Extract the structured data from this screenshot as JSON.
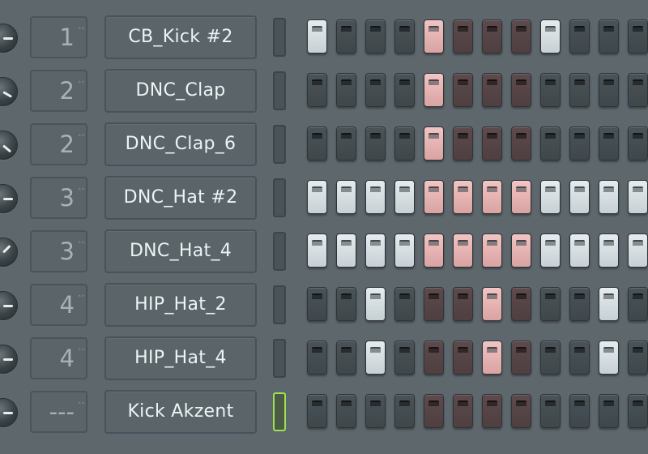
{
  "colors": {
    "background": "#5d676c",
    "step_off_grey": "#454d51",
    "step_off_brown": "#574546",
    "step_on_white": "#d6dee1",
    "step_on_pink": "#e6b3b2",
    "selected_led": "#9fe04e"
  },
  "channels": [
    {
      "channel": "1",
      "name": "CB_Kick #2",
      "knob_angle": 0,
      "selected": false,
      "steps": [
        1,
        0,
        0,
        0,
        1,
        0,
        0,
        0,
        1,
        0,
        0,
        0
      ]
    },
    {
      "channel": "2",
      "name": "DNC_Clap",
      "knob_angle": 30,
      "selected": false,
      "steps": [
        0,
        0,
        0,
        0,
        1,
        0,
        0,
        0,
        0,
        0,
        0,
        0
      ]
    },
    {
      "channel": "2",
      "name": "DNC_Clap_6",
      "knob_angle": 40,
      "selected": false,
      "steps": [
        0,
        0,
        0,
        0,
        1,
        0,
        0,
        0,
        0,
        0,
        0,
        0
      ]
    },
    {
      "channel": "3",
      "name": "DNC_Hat #2",
      "knob_angle": 0,
      "selected": false,
      "steps": [
        1,
        1,
        1,
        1,
        1,
        1,
        1,
        1,
        1,
        1,
        1,
        1
      ]
    },
    {
      "channel": "3",
      "name": "DNC_Hat_4",
      "knob_angle": -45,
      "selected": false,
      "steps": [
        1,
        1,
        1,
        1,
        1,
        1,
        1,
        1,
        1,
        1,
        1,
        1
      ]
    },
    {
      "channel": "4",
      "name": "HIP_Hat_2",
      "knob_angle": 0,
      "selected": false,
      "steps": [
        0,
        0,
        1,
        0,
        0,
        0,
        1,
        0,
        0,
        0,
        1,
        0
      ]
    },
    {
      "channel": "4",
      "name": "HIP_Hat_4",
      "knob_angle": 0,
      "selected": false,
      "steps": [
        0,
        0,
        1,
        0,
        0,
        0,
        1,
        0,
        0,
        0,
        1,
        0
      ]
    },
    {
      "channel": "---",
      "name": "Kick Akzent",
      "knob_angle": 0,
      "selected": true,
      "steps": [
        0,
        0,
        0,
        0,
        0,
        0,
        0,
        0,
        0,
        0,
        0,
        0
      ]
    }
  ],
  "step_group_pattern": [
    "grey",
    "grey",
    "grey",
    "grey",
    "brown",
    "brown",
    "brown",
    "brown",
    "grey",
    "grey",
    "grey",
    "grey"
  ]
}
